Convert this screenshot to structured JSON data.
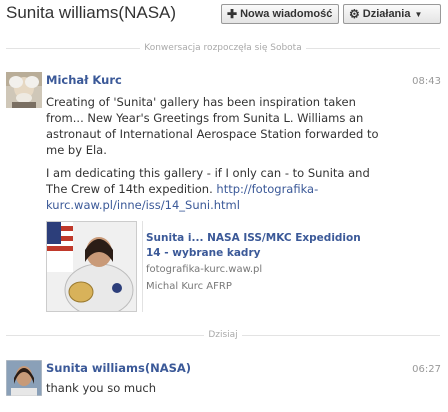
{
  "header": {
    "title": "Sunita williams(NASA)",
    "new_message": "Nowa wiadomość",
    "actions": "Działania"
  },
  "separators": {
    "started": "Konwersacja rozpoczęła się Sobota",
    "today": "Dzisiaj"
  },
  "messages": [
    {
      "sender": "Michał Kurc",
      "time": "08:43",
      "paragraph1": "Creating of 'Sunita' gallery has been inspiration taken from... New Year's Greetings from Sunita L. Williams an astronaut of International Aerospace Station forwarded to me by Ela.",
      "paragraph2": "I am dedicating this gallery - if I only can - to Sunita and The Crew of 14th expedition.",
      "link": "http://fotografika-kurc.waw.pl/inne/iss/14_Suni.html",
      "attachment": {
        "title": "Sunita i... NASA ISS/MKC Expedidion 14 - wybrane kadry",
        "domain": "fotografika-kurc.waw.pl",
        "author": "Michal Kurc AFRP"
      }
    },
    {
      "sender": "Sunita williams(NASA)",
      "time": "06:27",
      "text": "thank you so much"
    }
  ],
  "icons": {
    "new_message": "plus-icon",
    "actions": "gear-icon",
    "dropdown": "caret-down-icon"
  },
  "colors": {
    "link": "#3b5998",
    "timestamp": "#999999",
    "separator": "#aaaaaa"
  }
}
